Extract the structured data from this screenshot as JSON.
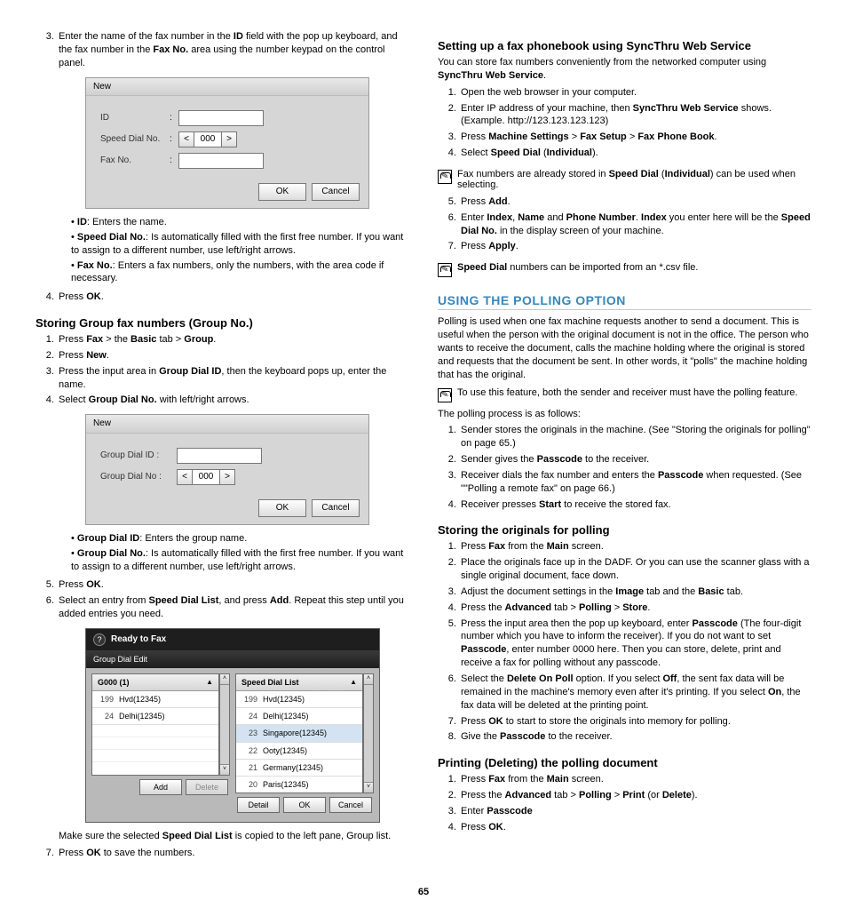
{
  "pageNumber": "65",
  "left": {
    "intro_step3_pre": "Enter the name of the fax number in the ",
    "intro_step3_id": "ID",
    "intro_step3_mid": " field with the pop up keyboard, and the fax number in the ",
    "intro_step3_fax": "Fax No.",
    "intro_step3_post": " area using the number keypad on the control panel.",
    "dlg1": {
      "title": "New",
      "id": "ID",
      "sdn": "Speed Dial No.",
      "num": "000",
      "fax": "Fax No.",
      "ok": "OK",
      "cancel": "Cancel"
    },
    "bullets1": {
      "a_b": "ID",
      "a_t": ": Enters the name.",
      "b_b": "Speed Dial No.",
      "b_t": ": Is automatically filled with the first free number. If you want to assign to a different number, use left/right arrows.",
      "c_b": "Fax No.",
      "c_t": ": Enters a fax numbers, only the numbers, with the area code if necessary."
    },
    "step4_pre": "Press ",
    "step4_b": "OK",
    "step4_post": ".",
    "h_group": "Storing Group fax numbers (Group No.)",
    "g1": {
      "pre": "Press ",
      "b1": "Fax",
      "mid1": " > the ",
      "b2": "Basic",
      "mid2": " tab > ",
      "b3": "Group",
      "post": "."
    },
    "g2": {
      "pre": "Press ",
      "b": "New",
      "post": "."
    },
    "g3": {
      "pre": "Press the input area in ",
      "b": "Group Dial ID",
      "post": ", then the keyboard pops up, enter the name."
    },
    "g4": {
      "pre": "Select ",
      "b": "Group Dial No.",
      "post": " with left/right arrows."
    },
    "dlg2": {
      "title": "New",
      "gid": "Group Dial ID :",
      "gno": "Group Dial No :",
      "num": "000",
      "ok": "OK",
      "cancel": "Cancel"
    },
    "bullets2": {
      "a_b": "Group Dial ID",
      "a_t": ": Enters the group name.",
      "b_b": "Group Dial No.",
      "b_t": ": Is automatically filled with the first free number. If you want to assign to a different number, use left/right arrows."
    },
    "g5": {
      "pre": "Press ",
      "b": "OK",
      "post": "."
    },
    "g6": {
      "pre": "Select an entry from ",
      "b1": "Speed Dial List",
      "mid": ", and press ",
      "b2": "Add",
      "post": ". Repeat this step until you added entries you need."
    },
    "rtf": {
      "top": "Ready to Fax",
      "tab": "Group Dial Edit",
      "left_h": "G000 (1)",
      "right_h": "Speed Dial List",
      "l_r1n": "199",
      "l_r1t": "Hvd(12345)",
      "l_r2n": "24",
      "l_r2t": "Delhi(12345)",
      "r_r1n": "199",
      "r_r1t": "Hvd(12345)",
      "r_r2n": "24",
      "r_r2t": "Delhi(12345)",
      "r_r3n": "23",
      "r_r3t": "Singapore(12345)",
      "r_r4n": "22",
      "r_r4t": "Ooty(12345)",
      "r_r5n": "21",
      "r_r5t": "Germany(12345)",
      "r_r6n": "20",
      "r_r6t": "Paris(12345)",
      "add": "Add",
      "del": "Delete",
      "det": "Detail",
      "ok": "OK",
      "cancel": "Cancel"
    },
    "afterRtf_pre": "Make sure the selected ",
    "afterRtf_b": "Speed Dial List",
    "afterRtf_post": " is copied to the left pane, Group list.",
    "g7": {
      "pre": "Press ",
      "b": "OK",
      "post": " to save the numbers."
    }
  },
  "right": {
    "h_sync": "Setting up a fax phonebook using SyncThru Web Service",
    "sync_intro_pre": "You can store fax numbers conveniently from the networked computer using ",
    "sync_intro_b": "SyncThru Web Service",
    "sync_intro_post": ".",
    "s1": "Open the web browser in your computer.",
    "s2_pre": "Enter IP address of your machine, then ",
    "s2_b": "SyncThru Web Service",
    "s2_post": " shows. (Example. http://123.123.123.123)",
    "s3_pre": "Press ",
    "s3_b1": "Machine Settings",
    "s3_m1": " > ",
    "s3_b2": "Fax Setup",
    "s3_m2": " > ",
    "s3_b3": "Fax Phone Book",
    "s3_post": ".",
    "s4_pre": "Select ",
    "s4_b1": "Speed Dial",
    "s4_m": " (",
    "s4_b2": "Individual",
    "s4_post": ").",
    "note1_pre": "Fax numbers are already stored in ",
    "note1_b1": "Speed Dial",
    "note1_m": " (",
    "note1_b2": "Individual",
    "note1_post": ") can be used when selecting.",
    "s5_pre": "Press ",
    "s5_b": "Add",
    "s5_post": ".",
    "s6_pre": "Enter ",
    "s6_b1": "Index",
    "s6_c1": ", ",
    "s6_b2": "Name",
    "s6_c2": " and ",
    "s6_b3": "Phone Number",
    "s6_c3": ". ",
    "s6_b4": "Index",
    "s6_mid": " you enter here will be the ",
    "s6_b5": "Speed Dial No.",
    "s6_post": " in the display screen of your machine.",
    "s7_pre": "Press ",
    "s7_b": "Apply",
    "s7_post": ".",
    "note2_b": "Speed Dial",
    "note2_t": " numbers can be imported from an *.csv file.",
    "h_poll": "Using the Polling Option",
    "poll_intro": "Polling is used when one fax machine requests another to send a document. This is useful when the person with the original document is not in the office. The person who wants to receive the document, calls the machine holding where the original is stored and requests that the document be sent. In other words, it \"polls\" the machine holding that has the original.",
    "note3": "To use this feature, both the sender and receiver must have the polling feature.",
    "poll_proc": "The polling process is as follows:",
    "p1": "Sender stores the originals in the machine. (See \"Storing the originals for polling\" on page 65.)",
    "p2_pre": "Sender gives the ",
    "p2_b": "Passcode",
    "p2_post": " to the receiver.",
    "p3_pre": "Receiver dials the fax number and enters the ",
    "p3_b": "Passcode",
    "p3_post": " when requested. (See \"\"Polling a remote fax\" on page 66.)",
    "p4_pre": "Receiver presses ",
    "p4_b": "Start",
    "p4_post": " to receive the stored fax.",
    "h_store": "Storing the originals for polling",
    "st1_pre": "Press ",
    "st1_b1": "Fax",
    "st1_m": " from the ",
    "st1_b2": "Main",
    "st1_post": " screen.",
    "st2": "Place the originals face up in the DADF. Or you can use the scanner glass with a single original document, face down.",
    "st3_pre": "Adjust the document settings in the ",
    "st3_b1": "Image",
    "st3_m": " tab and the ",
    "st3_b2": "Basic",
    "st3_post": " tab.",
    "st4_pre": "Press the ",
    "st4_b1": "Advanced",
    "st4_m1": " tab > ",
    "st4_b2": "Polling",
    "st4_m2": " > ",
    "st4_b3": "Store",
    "st4_post": ".",
    "st5_pre": "Press the input area then the pop up keyboard, enter ",
    "st5_b1": "Passcode",
    "st5_mid": " (The four-digit number which you have to inform the receiver). If you do not want to set ",
    "st5_b2": "Passcode",
    "st5_post": ", enter number 0000 here. Then you can store, delete, print and receive a fax for polling without any passcode.",
    "st6_pre": "Select the ",
    "st6_b1": "Delete On Poll",
    "st6_m1": " option. If you select ",
    "st6_b2": "Off",
    "st6_m2": ", the sent fax data will be remained in the machine's memory even after it's printing. If you select ",
    "st6_b3": "On",
    "st6_post": ", the fax data will be deleted at the printing point.",
    "st7_pre": "Press ",
    "st7_b": "OK",
    "st7_post": " to start to store the originals into memory for polling.",
    "st8_pre": "Give the ",
    "st8_b": "Passcode",
    "st8_post": " to the receiver.",
    "h_print": "Printing (Deleting) the polling document",
    "pr1_pre": "Press ",
    "pr1_b1": "Fax",
    "pr1_m": " from the ",
    "pr1_b2": "Main",
    "pr1_post": " screen.",
    "pr2_pre": "Press the ",
    "pr2_b1": "Advanced",
    "pr2_m1": " tab > ",
    "pr2_b2": "Polling",
    "pr2_m2": " > ",
    "pr2_b3": "Print",
    "pr2_m3": " (or ",
    "pr2_b4": "Delete",
    "pr2_post": ").",
    "pr3_pre": "Enter ",
    "pr3_b": "Passcode",
    "pr4_pre": "Press ",
    "pr4_b": "OK",
    "pr4_post": "."
  }
}
